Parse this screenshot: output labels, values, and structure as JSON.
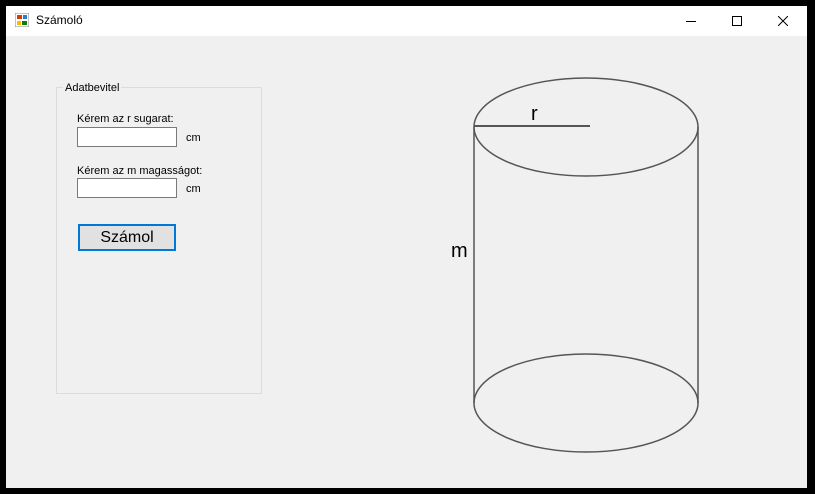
{
  "window": {
    "title": "Számoló"
  },
  "input_group": {
    "title": "Adatbevitel",
    "radius_label": "Kérem az r sugarat:",
    "radius_value": "",
    "radius_unit": "cm",
    "height_label": "Kérem az m magasságot:",
    "height_value": "",
    "height_unit": "cm",
    "calc_button": "Számol"
  },
  "diagram": {
    "radius_label": "r",
    "height_label": "m"
  },
  "icons": {
    "app": "app-icon",
    "minimize": "minimize-icon",
    "maximize": "maximize-icon",
    "close": "close-icon"
  },
  "colors": {
    "titlebar": "#ffffff",
    "window_bg": "#f0f0f0",
    "frame": "#000000",
    "button_focus_border": "#0078d7",
    "cylinder_stroke": "#555555"
  }
}
